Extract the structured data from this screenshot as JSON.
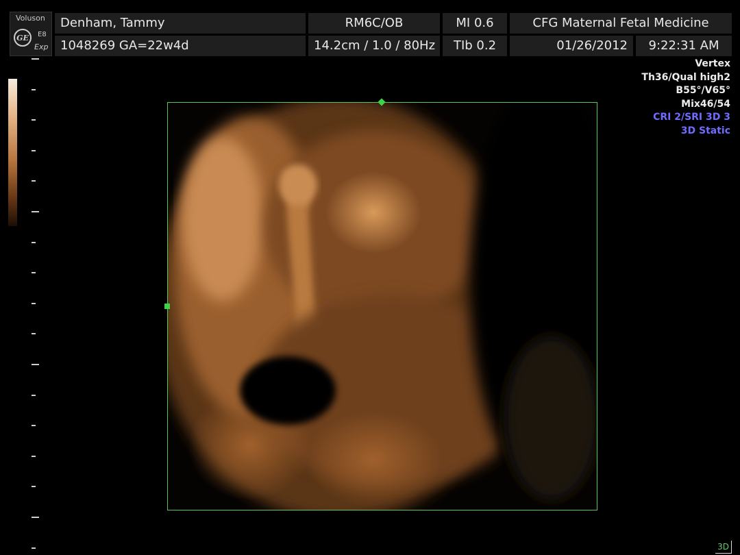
{
  "logo": {
    "brand": "Voluson",
    "emblem": "GE",
    "model": "E8",
    "edition": "Exp"
  },
  "header": {
    "patient_name": "Denham, Tammy",
    "probe_preset": "RM6C/OB",
    "mi": "MI  0.6",
    "site": "CFG Maternal Fetal Medicine",
    "patient_id_ga": "1048269  GA=22w4d",
    "depth_freq": "14.2cm / 1.0 / 80Hz",
    "tib": "TIb  0.2",
    "date": "01/26/2012",
    "time": "9:22:31 AM"
  },
  "info_panel": {
    "lines": [
      {
        "text": "Vertex",
        "color": "#ececec"
      },
      {
        "text": "Th36/Qual high2",
        "color": "#ececec"
      },
      {
        "text": "B55°/V65°",
        "color": "#ececec"
      },
      {
        "text": "Mix46/54",
        "color": "#ececec"
      },
      {
        "text": "CRI 2/SRI 3D 3",
        "color": "#6f6cff"
      },
      {
        "text": "3D Static",
        "color": "#6f6cff"
      }
    ]
  },
  "viewport": {
    "image_description_icon": "fetal-3d-render",
    "roi_color": "#55c95a"
  },
  "mode_badge": "3D",
  "colors": {
    "background": "#000000",
    "header_cell": "#1f1f1f",
    "render_tint": "#c47a3a"
  }
}
